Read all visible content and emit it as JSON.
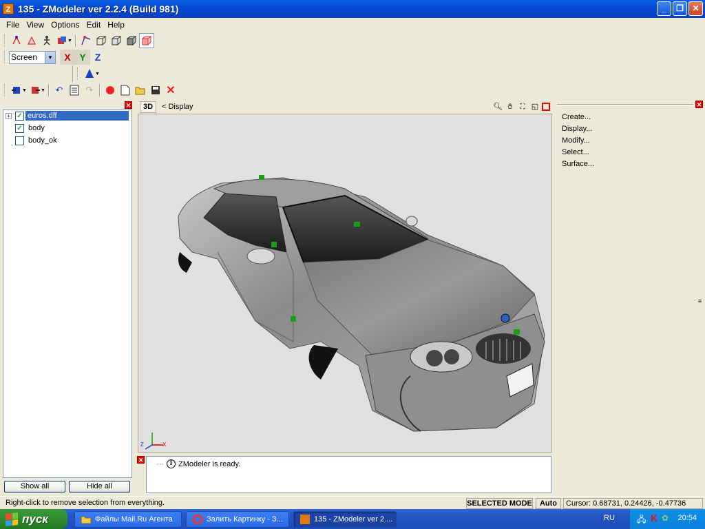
{
  "window": {
    "title": "135 - ZModeler ver 2.2.4 (Build 981)",
    "icon": "Z"
  },
  "menu": [
    "File",
    "View",
    "Options",
    "Edit",
    "Help"
  ],
  "toolbar": {
    "coord_system": "Screen",
    "axes": {
      "x": "X",
      "y": "Y",
      "z": "Z"
    }
  },
  "tree": {
    "items": [
      {
        "label": "euros.dff",
        "checked": true,
        "selected": true,
        "expandable": true
      },
      {
        "label": "body",
        "checked": true,
        "selected": false
      },
      {
        "label": "body_ok",
        "checked": false,
        "selected": false
      }
    ]
  },
  "left_buttons": {
    "show_all": "Show all",
    "hide_all": "Hide all"
  },
  "viewport": {
    "mode_button": "3D",
    "display_label": "< Display",
    "axis_z": "Z",
    "axis_x": "X"
  },
  "commands": [
    "Create...",
    "Display...",
    "Modify...",
    "Select...",
    "Surface..."
  ],
  "log": {
    "message": "ZModeler is ready."
  },
  "status": {
    "hint": "Right-click to remove selection from everything.",
    "mode": "SELECTED MODE",
    "auto": "Auto",
    "cursor": "Cursor: 0.68731, 0.24426, -0.47736"
  },
  "taskbar": {
    "start": "пуск",
    "tasks": [
      {
        "label": "Файлы Mail.Ru Агента"
      },
      {
        "label": "Залить Картинку - З..."
      },
      {
        "label": "135 - ZModeler ver 2...."
      }
    ],
    "language": "RU",
    "clock": "20:54"
  },
  "colors": {
    "selection": "#316ac5",
    "titlebar": "#0349d6",
    "handle": "#18a018"
  }
}
